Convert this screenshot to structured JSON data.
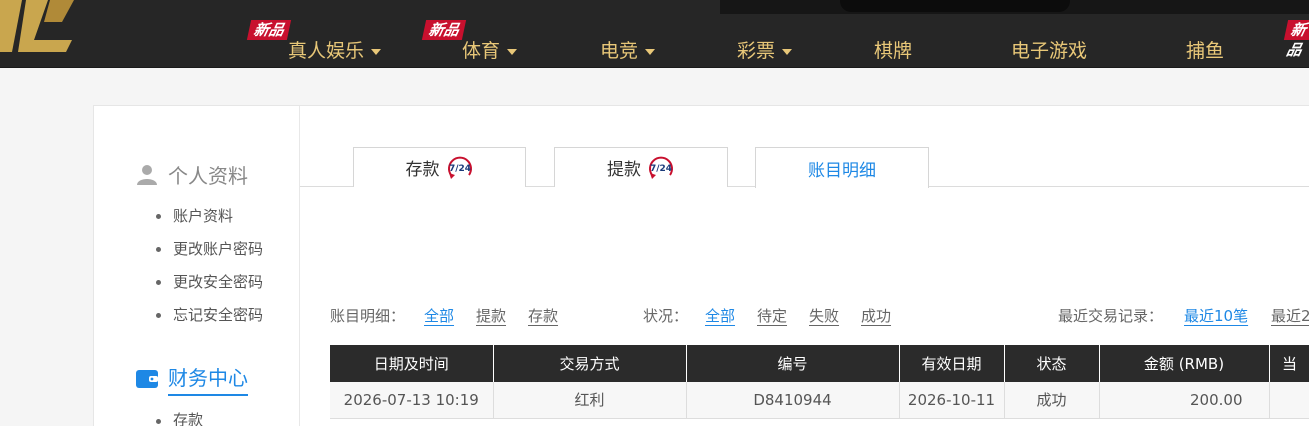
{
  "nav": {
    "items": [
      {
        "label": "真人娱乐",
        "dropdown": true,
        "badge": "新品"
      },
      {
        "label": "体育",
        "dropdown": true,
        "badge": "新品"
      },
      {
        "label": "电竞",
        "dropdown": true
      },
      {
        "label": "彩票",
        "dropdown": true
      },
      {
        "label": "棋牌"
      },
      {
        "label": "电子游戏"
      },
      {
        "label": "捕鱼"
      }
    ],
    "edge_badge": "新品"
  },
  "sidebar": {
    "profile_title": "个人资料",
    "profile_items": [
      "账户资料",
      "更改账户密码",
      "更改安全密码",
      "忘记安全密码"
    ],
    "finance_title": "财务中心",
    "finance_items": [
      "存款"
    ]
  },
  "tabs": [
    {
      "label": "存款",
      "icon": "24-7-icon",
      "icon_text": "7/24"
    },
    {
      "label": "提款",
      "icon": "24-7-icon",
      "icon_text": "7/24"
    },
    {
      "label": "账目明细",
      "active": true
    }
  ],
  "filters": {
    "detail_label": "账目明细：",
    "detail_options": [
      "全部",
      "提款",
      "存款"
    ],
    "detail_selected": "全部",
    "status_label": "状况：",
    "status_options": [
      "全部",
      "待定",
      "失败",
      "成功"
    ],
    "status_selected": "全部",
    "recent_label": "最近交易记录：",
    "recent_options": [
      "最近10笔",
      "最近2"
    ],
    "recent_selected": "最近10笔"
  },
  "table": {
    "headers": [
      "日期及时间",
      "交易方式",
      "编号",
      "有效日期",
      "状态",
      "金额 (RMB)",
      "当"
    ],
    "rows": [
      [
        "2026-07-13 10:19",
        "红利",
        "D8410944",
        "2026-10-11",
        "成功",
        "200.00",
        ""
      ]
    ]
  },
  "colors": {
    "topbar": "#262626",
    "nav_text": "#e8c778",
    "accent": "#1e88e5",
    "badge": "#c8102e"
  }
}
